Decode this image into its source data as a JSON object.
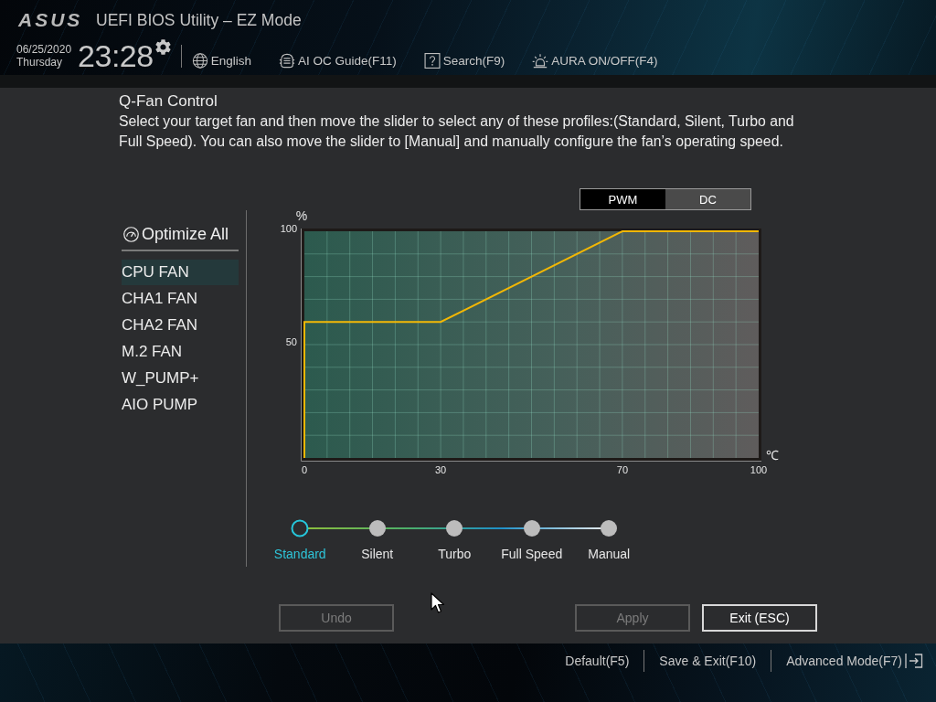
{
  "header": {
    "logo": "ASUS",
    "title": "UEFI BIOS Utility – EZ Mode",
    "date": "06/25/2020",
    "day": "Thursday",
    "time": "23:28",
    "tools": [
      {
        "kind": "language",
        "label": "English"
      },
      {
        "kind": "guide",
        "label": "AI OC Guide(F11)"
      },
      {
        "kind": "search",
        "label": "Search(F9)"
      },
      {
        "kind": "aura",
        "label": "AURA ON/OFF(F4)"
      }
    ]
  },
  "dialog": {
    "title": "Q-Fan Control",
    "description": "Select your target fan and then move the slider to select any of these profiles:(Standard, Silent, Turbo and Full Speed). You can also move the slider to [Manual] and manually configure the fan’s operating speed."
  },
  "mode_toggle": [
    {
      "label": "PWM",
      "selected": true
    },
    {
      "label": "DC",
      "selected": false
    }
  ],
  "fan_list": {
    "optimize_all": "Optimize All",
    "items": [
      {
        "label": "CPU FAN",
        "selected": true
      },
      {
        "label": "CHA1 FAN",
        "selected": false
      },
      {
        "label": "CHA2 FAN",
        "selected": false
      },
      {
        "label": "M.2 FAN",
        "selected": false
      },
      {
        "label": "W_PUMP+",
        "selected": false
      },
      {
        "label": "AIO PUMP",
        "selected": false
      }
    ]
  },
  "fan_curve": {
    "chart_data": {
      "type": "line",
      "xlabel": "℃",
      "ylabel": "%",
      "x": [
        0,
        0,
        30,
        70,
        100
      ],
      "values": [
        0,
        60,
        60,
        100,
        100
      ],
      "xlim": [
        0,
        100
      ],
      "ylim": [
        0,
        100
      ],
      "xticks": [
        0,
        30,
        70,
        100
      ],
      "yticks": [
        50,
        100
      ],
      "grid": true
    }
  },
  "profiles": [
    {
      "label": "Standard",
      "selected": true
    },
    {
      "label": "Silent",
      "selected": false
    },
    {
      "label": "Turbo",
      "selected": false
    },
    {
      "label": "Full Speed",
      "selected": false
    },
    {
      "label": "Manual",
      "selected": false
    }
  ],
  "buttons": [
    {
      "label": "Undo",
      "disabled": true
    },
    {
      "label": "Apply",
      "disabled": true
    },
    {
      "label": "Exit (ESC)",
      "disabled": false
    }
  ],
  "footer": {
    "links": [
      "Default(F5)",
      "Save & Exit(F10)"
    ],
    "advanced_mode": "Advanced Mode(F7)"
  }
}
